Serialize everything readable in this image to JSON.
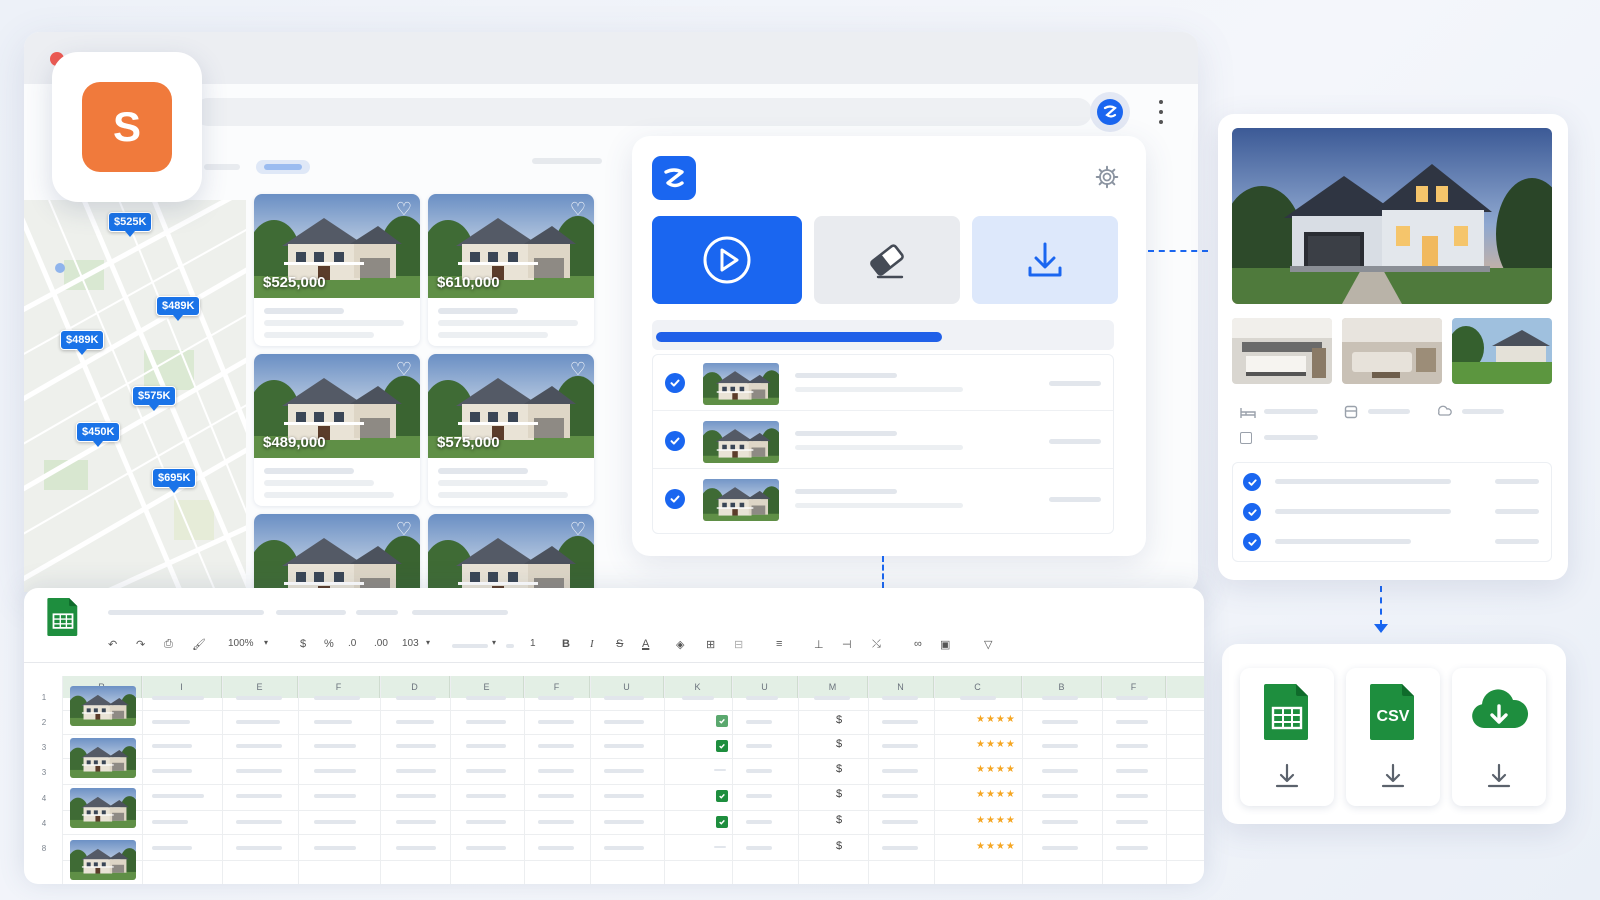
{
  "app": {
    "letter": "S",
    "accent": "#f07a3c"
  },
  "colors": {
    "primary": "#1a66f0",
    "sheets_green": "#1e8e3e",
    "star": "#f5a623",
    "pin": "#1a73e8"
  },
  "map": {
    "pins": [
      "$525K",
      "$489K",
      "$489K",
      "$575K",
      "$450K",
      "$695K"
    ]
  },
  "listings": [
    {
      "price": "$525,000"
    },
    {
      "price": "$610,000"
    },
    {
      "price": "$489,000"
    },
    {
      "price": "$575,000"
    },
    {
      "price": ""
    },
    {
      "price": ""
    }
  ],
  "extension": {
    "actions": [
      {
        "icon": "play-icon",
        "state": "active"
      },
      {
        "icon": "eraser-icon",
        "state": "neutral"
      },
      {
        "icon": "download-icon",
        "state": "light"
      }
    ],
    "progress": 0.63,
    "rows": 3
  },
  "sheet": {
    "toolbar": {
      "zoom": "100%",
      "currency": "$",
      "percent": "%",
      "decimals_dec": ".0",
      "decimals_inc": ".00",
      "number_format": "103",
      "font_size": "1",
      "bold": "B",
      "italic": "I",
      "strike": "S",
      "text_color": "A"
    },
    "columns": [
      "R",
      "I",
      "E",
      "F",
      "D",
      "E",
      "F",
      "U",
      "K",
      "U",
      "M",
      "N",
      "C",
      "B",
      "F"
    ],
    "row_numbers": [
      "1",
      "2",
      "3",
      "3",
      "4",
      "4",
      "8"
    ],
    "dollar": "$",
    "stars": "★★★★"
  },
  "export": {
    "items": [
      {
        "label": "",
        "icon": "google-sheets-icon"
      },
      {
        "label": "CSV",
        "icon": "csv-file-icon"
      },
      {
        "label": "",
        "icon": "cloud-upload-icon"
      }
    ]
  }
}
